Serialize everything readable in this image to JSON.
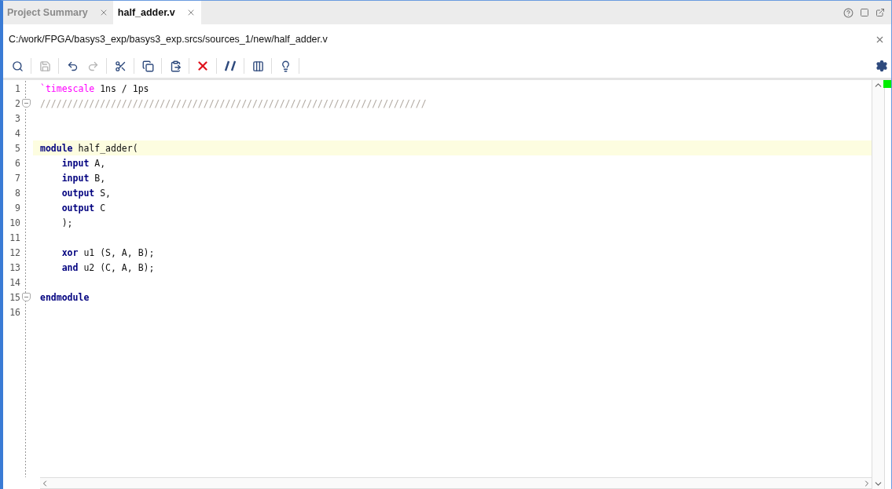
{
  "tabs": [
    {
      "label": "Project Summary",
      "selected": false
    },
    {
      "label": "half_adder.v",
      "selected": true
    }
  ],
  "file_path": "C:/work/FPGA/basys3_exp/basys3_exp.srcs/sources_1/new/half_adder.v",
  "toolbar": [
    {
      "kind": "search",
      "disabled": false
    },
    {
      "kind": "save",
      "disabled": true
    },
    {
      "kind": "undo",
      "disabled": false
    },
    {
      "kind": "redo",
      "disabled": true
    },
    {
      "kind": "cut",
      "disabled": false
    },
    {
      "kind": "copy",
      "disabled": false
    },
    {
      "kind": "paste",
      "disabled": false
    },
    {
      "kind": "delete",
      "disabled": false
    },
    {
      "kind": "comment",
      "disabled": false
    },
    {
      "kind": "columns",
      "disabled": false
    },
    {
      "kind": "hint",
      "disabled": false
    }
  ],
  "editor": {
    "lines": [
      {
        "number": "1",
        "fold": false,
        "current": false,
        "tokens": [
          {
            "kind": "directive",
            "text": "`timescale"
          },
          {
            "kind": "plain",
            "text": " 1ns / 1ps"
          }
        ]
      },
      {
        "number": "2",
        "fold": true,
        "current": false,
        "tokens": [
          {
            "kind": "comment",
            "text": "///////////////////////////////////////////////////////////////////////"
          }
        ]
      },
      {
        "number": "3",
        "fold": false,
        "current": false
      },
      {
        "number": "4",
        "fold": false,
        "current": false
      },
      {
        "number": "5",
        "fold": false,
        "current": true,
        "tokens": [
          {
            "kind": "keyword",
            "text": "module"
          },
          {
            "kind": "plain",
            "text": " half_adder("
          }
        ]
      },
      {
        "number": "6",
        "fold": false,
        "current": false,
        "tokens": [
          {
            "kind": "keyword",
            "text": "    input"
          },
          {
            "kind": "plain",
            "text": " A,"
          }
        ]
      },
      {
        "number": "7",
        "fold": false,
        "current": false,
        "tokens": [
          {
            "kind": "keyword",
            "text": "    input"
          },
          {
            "kind": "plain",
            "text": " B,"
          }
        ]
      },
      {
        "number": "8",
        "fold": false,
        "current": false,
        "tokens": [
          {
            "kind": "keyword",
            "text": "    output"
          },
          {
            "kind": "plain",
            "text": " S,"
          }
        ]
      },
      {
        "number": "9",
        "fold": false,
        "current": false,
        "tokens": [
          {
            "kind": "keyword",
            "text": "    output"
          },
          {
            "kind": "plain",
            "text": " C"
          }
        ]
      },
      {
        "number": "10",
        "fold": false,
        "current": false,
        "tokens": [
          {
            "kind": "plain",
            "text": "    );"
          }
        ]
      },
      {
        "number": "11",
        "fold": false,
        "current": false
      },
      {
        "number": "12",
        "fold": false,
        "current": false,
        "tokens": [
          {
            "kind": "keyword",
            "text": "    xor"
          },
          {
            "kind": "plain",
            "text": " u1 (S, A, B);"
          }
        ]
      },
      {
        "number": "13",
        "fold": false,
        "current": false,
        "tokens": [
          {
            "kind": "keyword",
            "text": "    and"
          },
          {
            "kind": "plain",
            "text": " u2 (C, A, B);"
          }
        ]
      },
      {
        "number": "14",
        "fold": false,
        "current": false
      },
      {
        "number": "15",
        "fold": true,
        "current": false,
        "tokens": [
          {
            "kind": "keyword",
            "text": "endmodule"
          }
        ]
      },
      {
        "number": "16",
        "fold": false,
        "current": false
      }
    ]
  }
}
